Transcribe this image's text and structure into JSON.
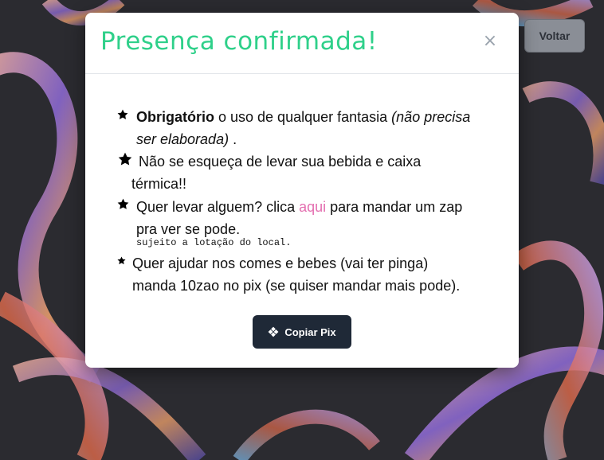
{
  "header_button": {
    "label": "Voltar"
  },
  "modal": {
    "title": "Presença confirmada!",
    "close_glyph": "×",
    "items": [
      {
        "bold": "Obrigatório",
        "text": " o uso de qualquer fantasia ",
        "italic": "(não precisa ser elaborada)",
        "tail": " ."
      },
      {
        "line1": "Não se esqueça de levar sua bebida e caixa",
        "line2": "térmica!!"
      },
      {
        "pre": "Quer levar alguem? clica ",
        "link": "aqui",
        "post": " para mandar um zap",
        "line2": "pra ver se pode.",
        "note": "sujeito a lotação do local."
      },
      {
        "line1": "Quer ajudar nos comes e bebes (vai ter pinga)",
        "line2": "manda 10zao no pix (se quiser mandar mais pode)."
      }
    ],
    "pix_button": {
      "label": "Copiar Pix",
      "icon": "pix-icon"
    }
  },
  "icons": {
    "list_marker": "star-icon",
    "close": "close-icon"
  },
  "colors": {
    "title": "#2fd08a",
    "link": "#e46fb0",
    "pix_button": "#1f2937",
    "voltar_button": "#8a8e96"
  }
}
